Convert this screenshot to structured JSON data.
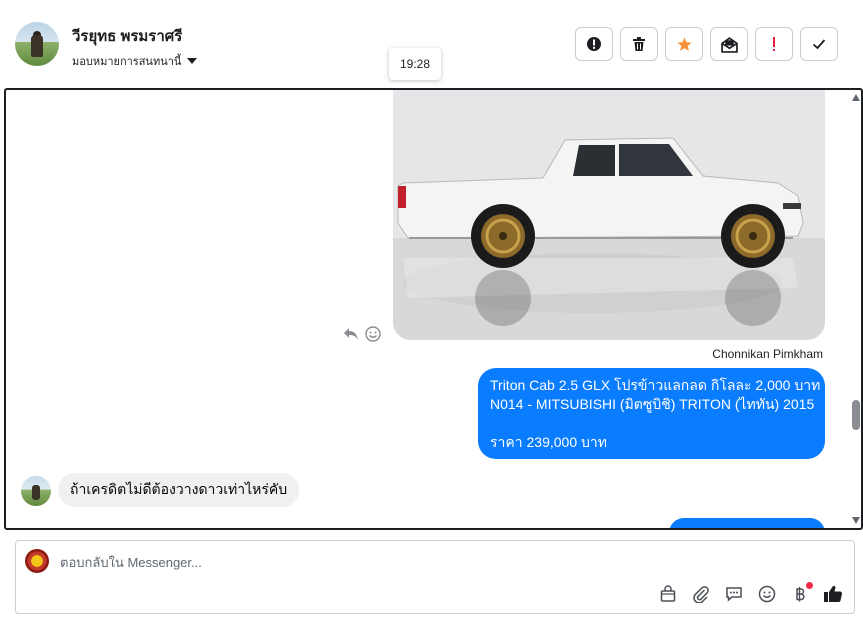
{
  "header": {
    "contact_name": "วีรยุทธ พรมราศรี",
    "assign_label": "มอบหมายการสนทนานี้",
    "actions": [
      {
        "name": "report-spam-button",
        "icon": "alert-circle-icon"
      },
      {
        "name": "delete-button",
        "icon": "trash-icon"
      },
      {
        "name": "star-button",
        "icon": "star-icon",
        "color": "#f7923a"
      },
      {
        "name": "mark-unread-button",
        "icon": "envelope-open-icon"
      },
      {
        "name": "follow-up-button",
        "icon": "exclamation-icon",
        "color": "#e41e3f"
      },
      {
        "name": "mark-done-button",
        "icon": "check-icon"
      }
    ]
  },
  "tooltip": {
    "time": "19:28"
  },
  "conversation": {
    "sender_name": "Chonnikan Pimkham",
    "outgoing": {
      "line1": "Triton Cab 2.5 GLX โปรข้าวแลกลด กิโลละ 2,000 บาท",
      "line2": "N014 - MITSUBISHI (มิตซูบิชิ) TRITON (ไททัน) 2015",
      "price": "ราคา 239,000 บาท"
    },
    "incoming": {
      "text": "ถ้าเครดิตไม่ดีต้องวางดาวเท่าไหร่คับ"
    }
  },
  "composer": {
    "placeholder": "ตอบกลับใน Messenger...",
    "tools": [
      "shopping-bag-icon",
      "paperclip-icon",
      "saved-reply-icon",
      "emoji-icon",
      "baht-icon",
      "thumbs-up-icon"
    ]
  },
  "colors": {
    "accent": "#0a7cff",
    "incoming_bubble": "#f0f0f0",
    "notify_dot": "#f02849"
  }
}
